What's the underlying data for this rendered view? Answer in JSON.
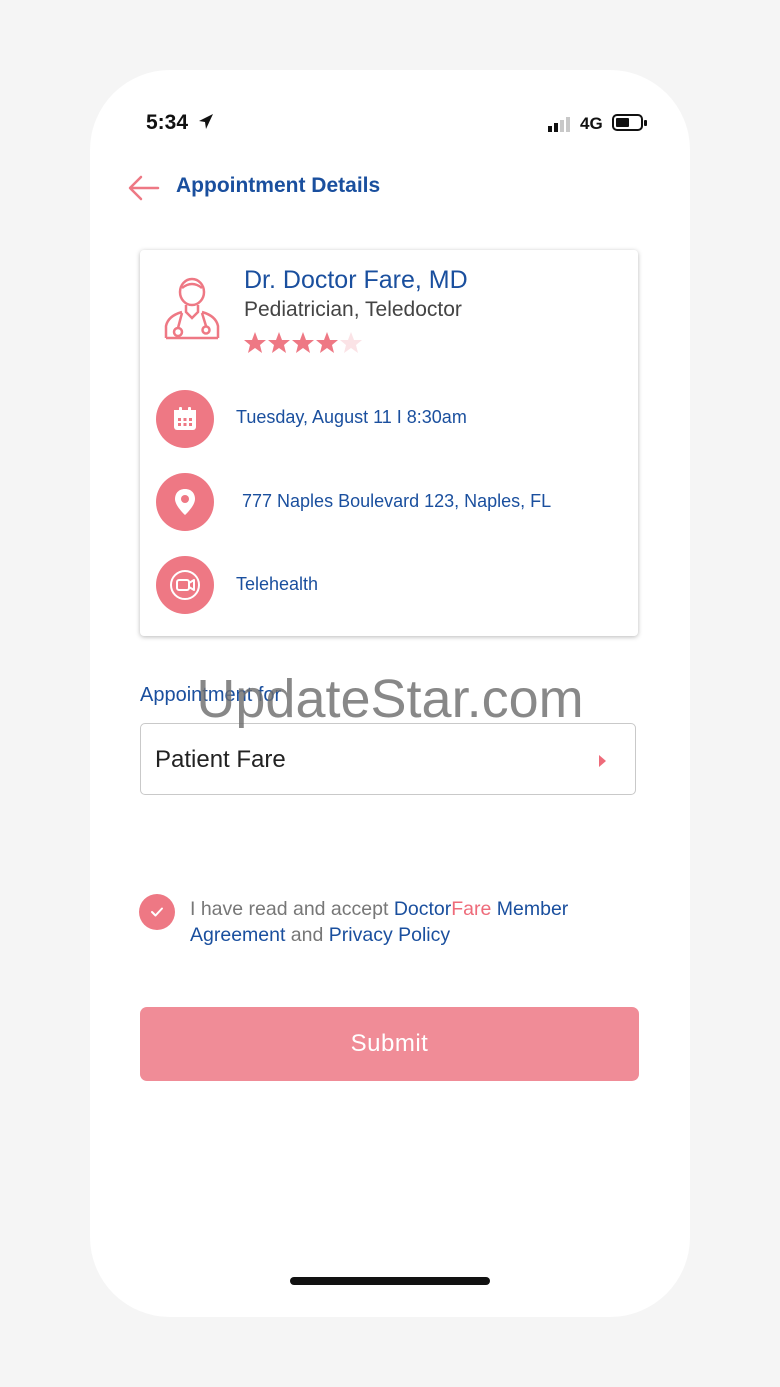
{
  "status_bar": {
    "time": "5:34",
    "network": "4G"
  },
  "header": {
    "title": "Appointment Details"
  },
  "doctor": {
    "name": "Dr. Doctor Fare, MD",
    "specialty": "Pediatrician, Teledoctor",
    "rating": 4,
    "rating_max": 5
  },
  "details": {
    "datetime": "Tuesday, August 11 I 8:30am",
    "address": "777 Naples Boulevard 123, Naples, FL",
    "visit_type": "Telehealth"
  },
  "appointment_for": {
    "label": "Appointment for",
    "value": "Patient Fare"
  },
  "agreement": {
    "checked": true,
    "prefix": "I have read and accept ",
    "brand_part1": "Doctor",
    "brand_part2": "Fare",
    "member_agreement": " Member Agreement",
    "and": " and ",
    "privacy_policy": "Privacy Policy"
  },
  "submit": {
    "label": "Submit"
  },
  "watermark": "UpdateStar.com",
  "colors": {
    "accent_pink": "#ee7884",
    "brand_blue": "#1a4f9e",
    "button_pink": "#f08c97"
  },
  "icons": {
    "back": "arrow-left-icon",
    "avatar": "doctor-avatar-icon",
    "calendar": "calendar-icon",
    "location": "map-pin-icon",
    "video": "video-camera-icon",
    "caret": "caret-right-icon",
    "check": "check-icon"
  }
}
